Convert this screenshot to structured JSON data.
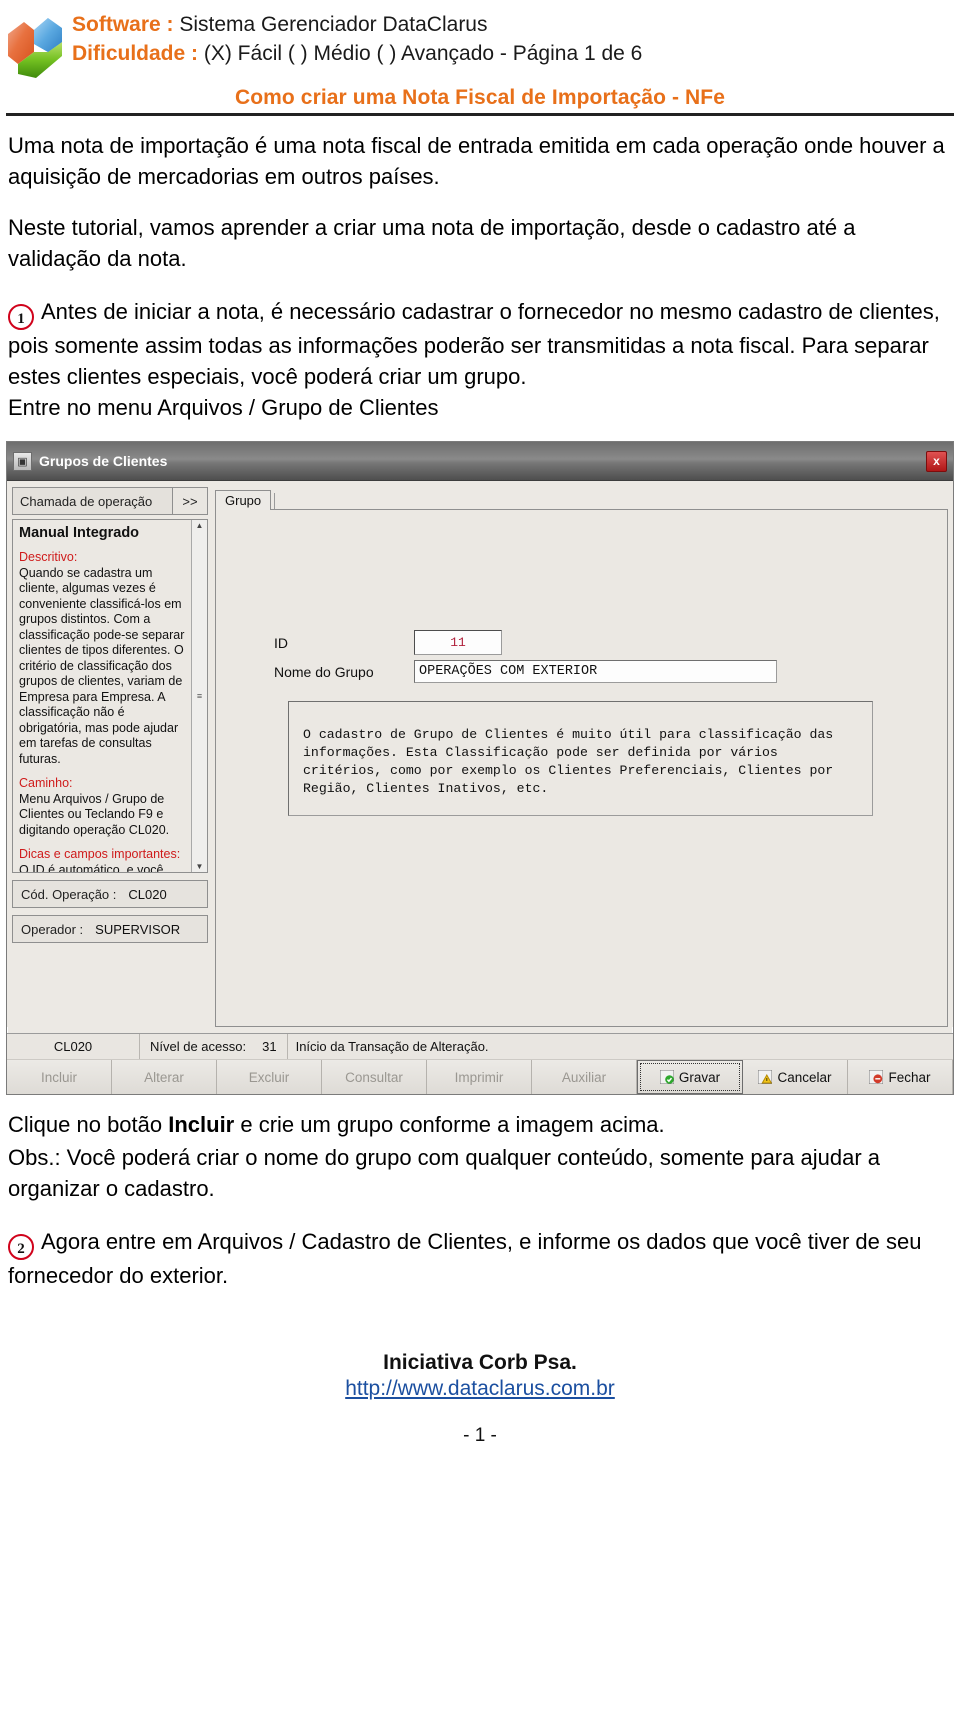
{
  "header": {
    "software_label": "Software :",
    "software_value": "Sistema Gerenciador DataClarus",
    "difficulty_label": "Dificuldade :",
    "difficulty_value": "(X) Fácil ( ) Médio ( ) Avançado - Página 1 de 6",
    "subtitle": "Como criar uma Nota Fiscal de Importação - NFe",
    "accent_color": "#E8701A",
    "logo_icon": "dataclarus-puzzle-logo"
  },
  "intro": {
    "p1": "Uma nota de importação é uma nota fiscal de entrada emitida em cada operação onde houver a aquisição de mercadorias em outros países.",
    "p2": "Neste tutorial, vamos aprender a criar uma nota de importação, desde o cadastro até a validação da nota."
  },
  "step1": {
    "number": "1",
    "text": "Antes de iniciar a nota, é necessário cadastrar o fornecedor no mesmo cadastro de clientes, pois somente assim todas as informações poderão ser transmitidas a nota fiscal. Para separar estes clientes especiais, você poderá criar um grupo.",
    "menu_line": "Entre no menu Arquivos / Grupo de Clientes"
  },
  "window": {
    "title": "Grupos de Clientes",
    "window_icon": "app-window-icon",
    "close_icon": "x",
    "left": {
      "op_call_label": "Chamada de operação",
      "op_call_button": ">>",
      "manual_title": "Manual Integrado",
      "sections": [
        {
          "heading": "Descritivo:",
          "body": "Quando se cadastra um cliente, algumas vezes é conveniente classificá-los em grupos distintos. Com a classificação pode-se separar clientes de tipos diferentes. O critério de classificação dos grupos de clientes, variam de Empresa para Empresa. A classificação não é obrigatória, mas pode ajudar em tarefas de consultas futuras."
        },
        {
          "heading": "Caminho:",
          "body": "Menu Arquivos / Grupo de Clientes  ou Teclando F9 e digitando operação CL020."
        },
        {
          "heading": "Dicas e campos importantes:",
          "body": "O ID é automático, e você terá apenas que informar o"
        }
      ],
      "scroll_up_icon": "▲",
      "scroll_down_icon": "▼",
      "scroll_grip_icon": "≡",
      "cod_operacao_label": "Cód. Operação :",
      "cod_operacao_value": "CL020",
      "operador_label": "Operador :",
      "operador_value": "SUPERVISOR"
    },
    "right": {
      "tab_label": "Grupo",
      "id_label": "ID",
      "id_value": "11",
      "id_value_color": "#b0213c",
      "name_label": "Nome do Grupo",
      "name_value": "OPERAÇÕES COM EXTERIOR",
      "description": "O cadastro de Grupo de Clientes é muito útil para classificação das informações. Esta Classificação pode ser definida por vários critérios, como por exemplo os Clientes Preferenciais, Clientes por Região, Clientes Inativos, etc."
    },
    "statusbar": {
      "code": "CL020",
      "access_label": "Nível de acesso:",
      "access_value": "31",
      "message": "Início da Transação de Alteração."
    },
    "buttons": [
      {
        "label": "Incluir",
        "accel": "I",
        "enabled": false,
        "icon": ""
      },
      {
        "label": "Alterar",
        "accel": "A",
        "enabled": false,
        "icon": ""
      },
      {
        "label": "Excluir",
        "accel": "E",
        "enabled": false,
        "icon": ""
      },
      {
        "label": "Consultar",
        "accel": "C",
        "enabled": false,
        "icon": ""
      },
      {
        "label": "Imprimir",
        "accel": "I",
        "enabled": false,
        "icon": ""
      },
      {
        "label": "Auxiliar",
        "accel": "x",
        "enabled": false,
        "icon": ""
      },
      {
        "label": "Gravar",
        "accel": "G",
        "enabled": true,
        "icon": "green-check-disk-icon"
      },
      {
        "label": "Cancelar",
        "accel": "c",
        "enabled": true,
        "icon": "yellow-warning-icon"
      },
      {
        "label": "Fechar",
        "accel": "F",
        "enabled": true,
        "icon": "red-exit-icon"
      }
    ]
  },
  "after_window": {
    "line1_pre": "Clique no botão ",
    "line1_bold": "Incluir",
    "line1_post": " e crie um grupo conforme a imagem acima.",
    "line2": "Obs.: Você poderá criar o nome do grupo com qualquer conteúdo, somente para ajudar a organizar o cadastro."
  },
  "step2": {
    "number": "2",
    "text": "Agora entre em Arquivos / Cadastro de Clientes, e informe os dados que você tiver de seu fornecedor do exterior."
  },
  "footer": {
    "initiative": "Iniciativa Corb Psa.",
    "url": "http://www.dataclarus.com.br",
    "page": "- 1 -"
  }
}
